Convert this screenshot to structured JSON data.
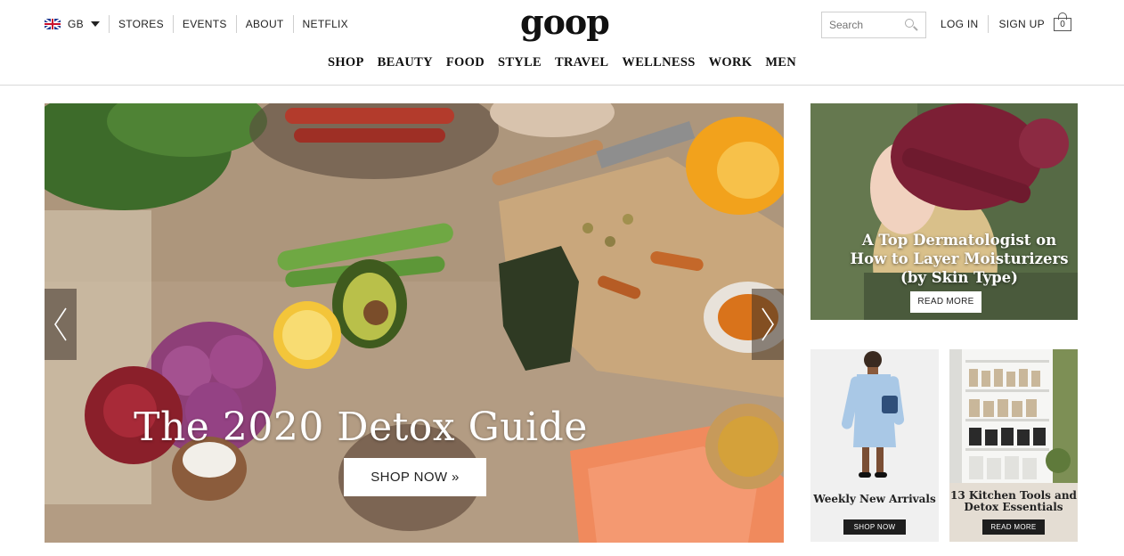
{
  "header": {
    "region": {
      "code": "GB",
      "flag_icon": "uk-flag-icon"
    },
    "util_links": [
      "STORES",
      "EVENTS",
      "ABOUT",
      "NETFLIX"
    ],
    "logo": "goop",
    "search": {
      "placeholder": "Search",
      "icon": "search-icon"
    },
    "account_links": [
      "LOG IN",
      "SIGN UP"
    ],
    "cart": {
      "count": "0",
      "icon": "shopping-bag-icon"
    }
  },
  "main_nav": [
    "SHOP",
    "BEAUTY",
    "FOOD",
    "STYLE",
    "TRAVEL",
    "WELLNESS",
    "WORK",
    "MEN"
  ],
  "hero": {
    "title": "The 2020 Detox Guide",
    "button": "SHOP NOW »",
    "prev_icon": "chevron-left-icon",
    "next_icon": "chevron-right-icon"
  },
  "feature": {
    "title": "A Top Dermatologist on How to Layer Moisturizers (by Skin Type)",
    "button": "READ MORE"
  },
  "cards": [
    {
      "caption": "Weekly New Arrivals",
      "button": "SHOP NOW"
    },
    {
      "caption": "13 Kitchen Tools and Detox Essentials",
      "button": "READ MORE"
    }
  ],
  "colors": {
    "text": "#222222",
    "divider": "#d9d9d9",
    "button_dark": "#1e1e1e"
  }
}
